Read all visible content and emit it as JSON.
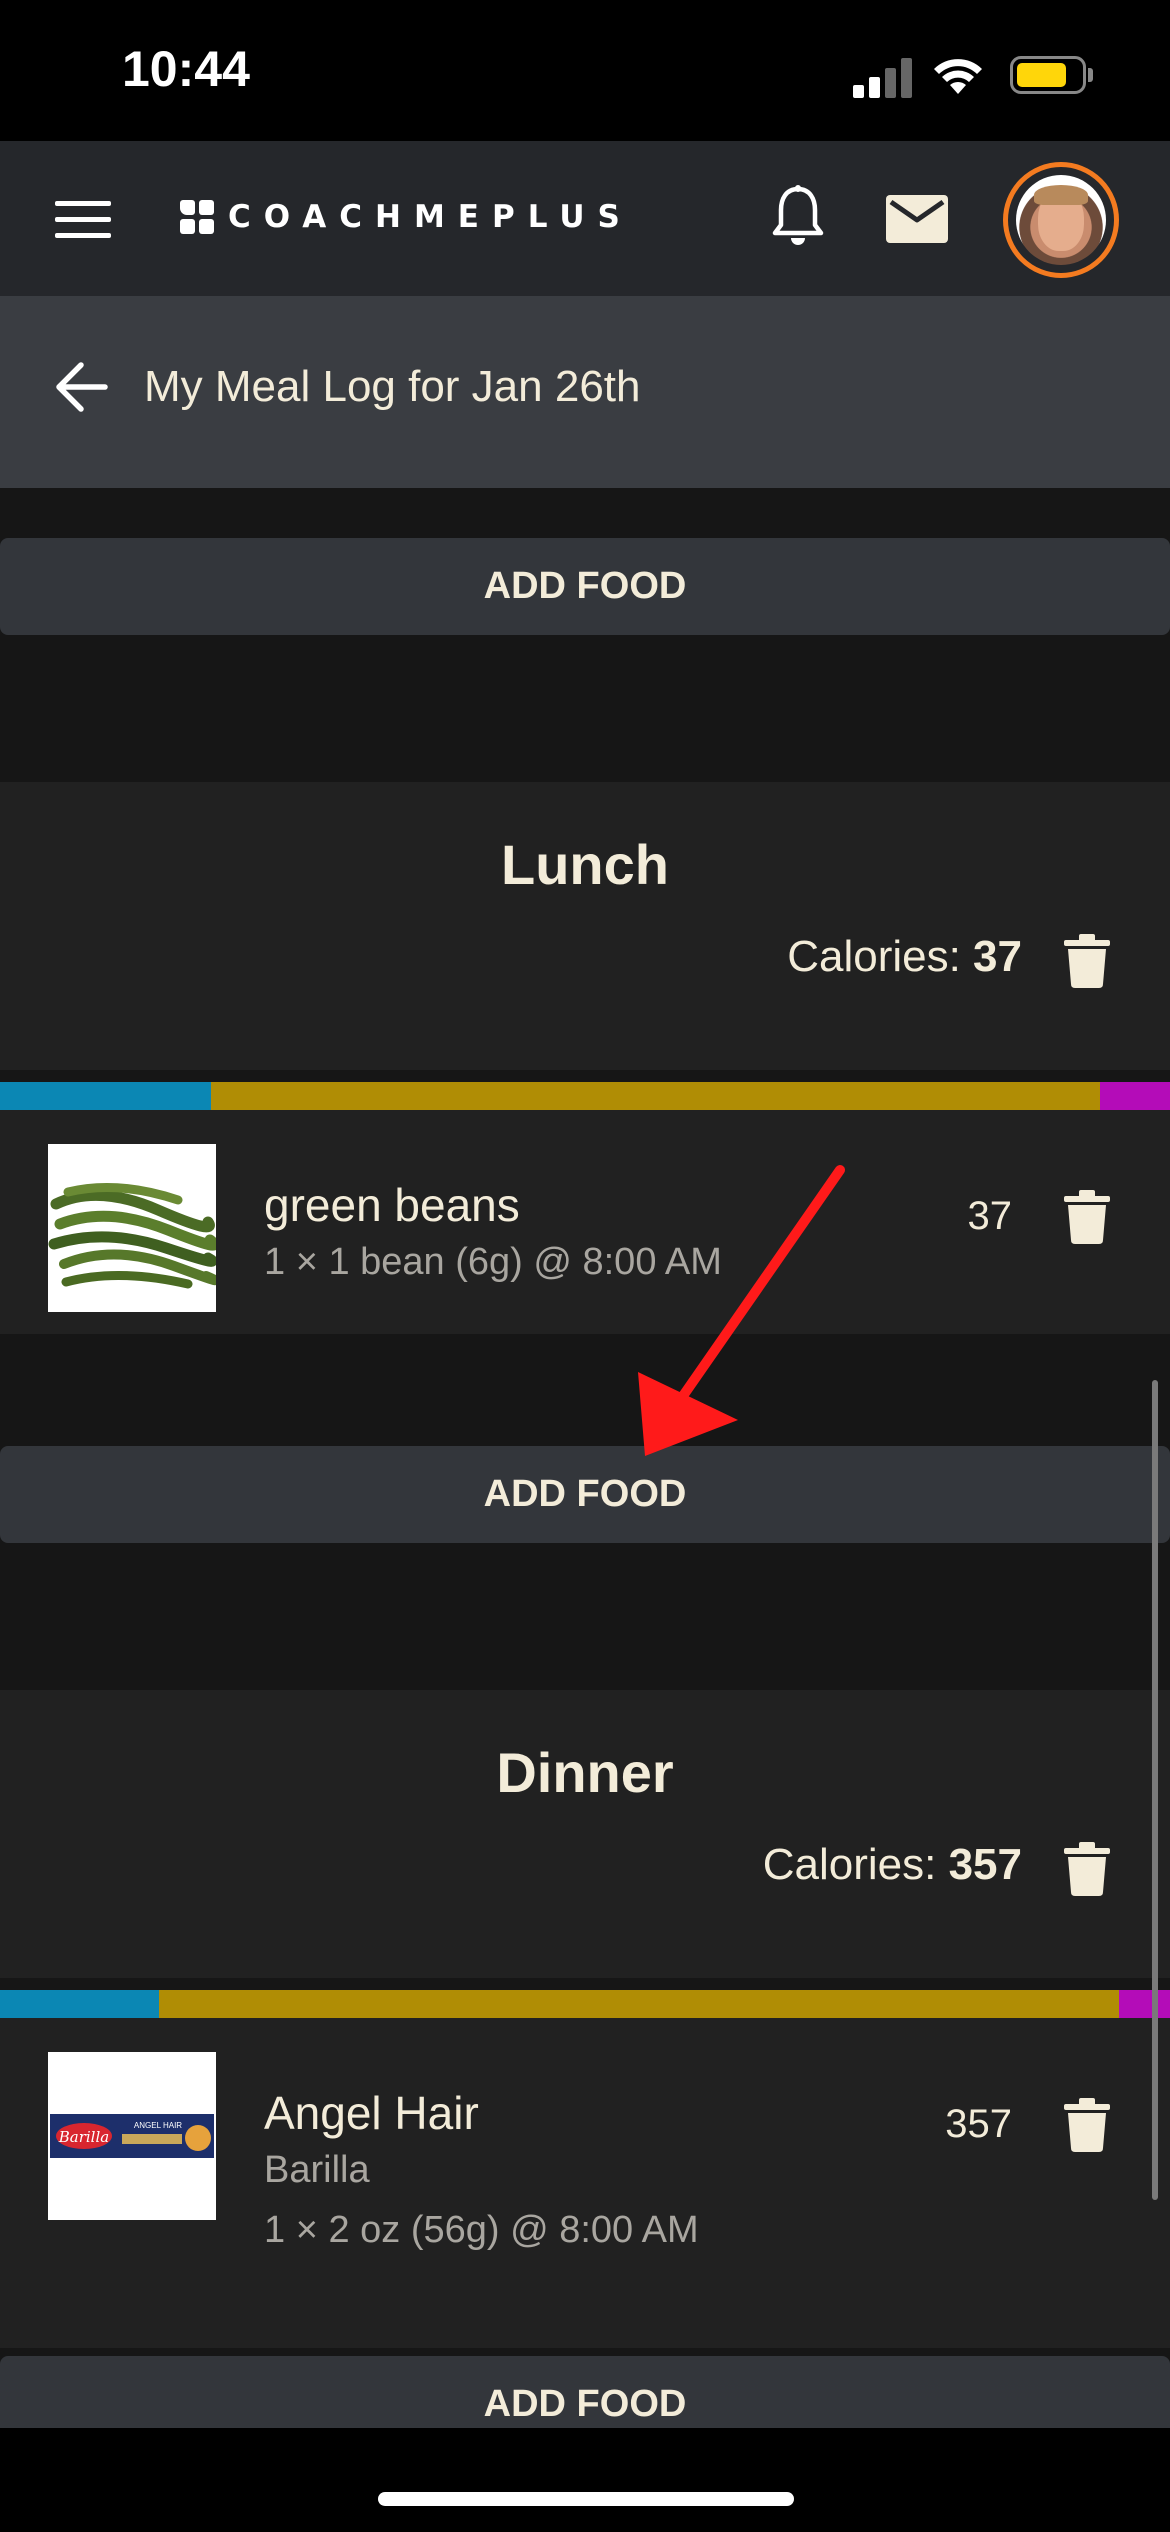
{
  "status_bar": {
    "time": "10:44",
    "battery_level": 0.7
  },
  "header": {
    "logo_text": "COACHMEPLUS"
  },
  "title_bar": {
    "title": "My Meal Log for Jan 26th"
  },
  "add_food_label": "ADD FOOD",
  "meals": [
    {
      "name": "Lunch",
      "calories_label": "Calories: ",
      "calories": "37",
      "macro_colors": [
        "#0b87b4",
        "#b08d05",
        "#b40cb8"
      ],
      "macro_fractions": [
        0.18,
        0.76,
        0.06
      ],
      "items": [
        {
          "name": "green beans",
          "brand": "",
          "detail": "1 × 1 bean (6g) @ 8:00 AM",
          "calories": "37"
        }
      ]
    },
    {
      "name": "Dinner",
      "calories_label": "Calories: ",
      "calories": "357",
      "macro_colors": [
        "#0b87b4",
        "#b08d05",
        "#b40cb8"
      ],
      "macro_fractions": [
        0.136,
        0.82,
        0.044
      ],
      "items": [
        {
          "name": "Angel Hair",
          "brand": "Barilla",
          "detail": "1 × 2 oz (56g) @ 8:00 AM",
          "calories": "357",
          "image_text": "Barilla",
          "image_subtext": "ANGEL HAIR"
        }
      ]
    }
  ],
  "annotation": {
    "color": "#ff1a1a"
  }
}
